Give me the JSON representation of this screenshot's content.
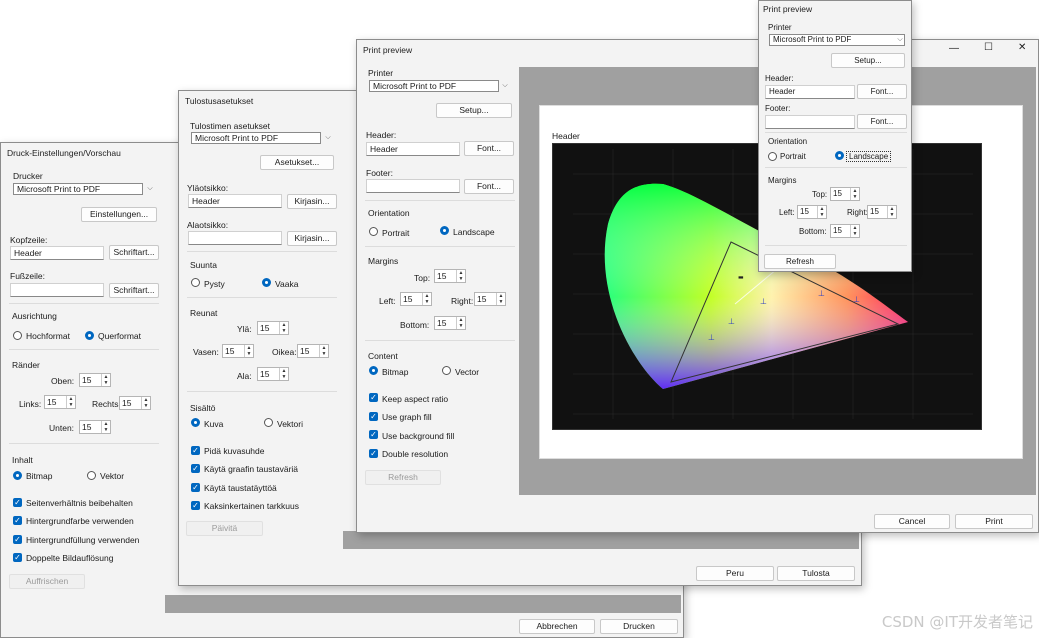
{
  "german": {
    "title": "Druck-Einstellungen/Vorschau",
    "printer_label": "Drucker",
    "printer_value": "Microsoft Print to PDF",
    "settings_button": "Einstellungen...",
    "header_label": "Kopfzeile:",
    "header_value": "Header",
    "footer_label": "Fußzeile:",
    "font_button": "Schriftart...",
    "orientation_label": "Ausrichtung",
    "portrait": "Hochformat",
    "landscape": "Querformat",
    "margins_label": "Ränder",
    "top": "Oben:",
    "left": "Links:",
    "right": "Rechts:",
    "bottom": "Unten:",
    "margin_value": "15",
    "content_label": "Inhalt",
    "bitmap": "Bitmap",
    "vector": "Vektor",
    "keep_aspect": "Seitenverhältnis beibehalten",
    "graph_fill": "Hintergrundfarbe verwenden",
    "bg_fill": "Hintergrundfüllung verwenden",
    "double_res": "Doppelte Bildauflösung",
    "refresh": "Auffrischen",
    "cancel": "Abbrechen",
    "print": "Drucken"
  },
  "finnish": {
    "title": "Tulostusasetukset",
    "printer_label": "Tulostimen asetukset",
    "printer_value": "Microsoft Print to PDF",
    "settings_button": "Asetukset...",
    "header_label": "Yläotsikko:",
    "header_value": "Header",
    "footer_label": "Alaotsikko:",
    "font_button": "Kirjasin...",
    "orientation_label": "Suunta",
    "portrait": "Pysty",
    "landscape": "Vaaka",
    "margins_label": "Reunat",
    "top": "Ylä:",
    "left": "Vasen:",
    "right": "Oikea:",
    "bottom": "Ala:",
    "margin_value": "15",
    "content_label": "Sisältö",
    "bitmap": "Kuva",
    "vector": "Vektori",
    "keep_aspect": "Pidä kuvasuhde",
    "graph_fill": "Käytä graafin taustaväriä",
    "bg_fill": "Käytä taustatäyttöä",
    "double_res": "Kaksinkertainen tarkkuus",
    "refresh": "Päivitä",
    "cancel": "Peru",
    "print": "Tulosta"
  },
  "english": {
    "title": "Print preview",
    "printer_label": "Printer",
    "printer_value": "Microsoft Print to PDF",
    "settings_button": "Setup...",
    "header_label": "Header:",
    "header_value": "Header",
    "footer_label": "Footer:",
    "font_button": "Font...",
    "orientation_label": "Orientation",
    "portrait": "Portrait",
    "landscape": "Landscape",
    "margins_label": "Margins",
    "top": "Top:",
    "left": "Left:",
    "right": "Right:",
    "bottom": "Bottom:",
    "margin_value": "15",
    "content_label": "Content",
    "bitmap": "Bitmap",
    "vector": "Vector",
    "keep_aspect": "Keep aspect ratio",
    "graph_fill": "Use graph fill",
    "bg_fill": "Use background fill",
    "double_res": "Double resolution",
    "refresh": "Refresh",
    "cancel": "Cancel",
    "print": "Print",
    "page_header": "Header"
  },
  "small": {
    "title": "Print preview",
    "printer_label": "Printer",
    "printer_value": "Microsoft Print to PDF",
    "settings_button": "Setup...",
    "header_label": "Header:",
    "header_value": "Header",
    "footer_label": "Footer:",
    "font_button": "Font...",
    "orientation_label": "Orientation",
    "portrait": "Portrait",
    "landscape": "Landscape",
    "margins_label": "Margins",
    "top": "Top:",
    "left": "Left:",
    "right": "Right:",
    "bottom": "Bottom:",
    "margin_value": "15",
    "refresh": "Refresh"
  },
  "window_controls": {
    "minimize": "—",
    "maximize": "☐",
    "close": "✕"
  },
  "watermark": "CSDN @IT开发者笔记",
  "colors": {
    "accent": "#0067c0",
    "dialog_bg": "#f3f3f3",
    "preview_bg": "#a0a0a0",
    "chart_bg": "#111111"
  }
}
